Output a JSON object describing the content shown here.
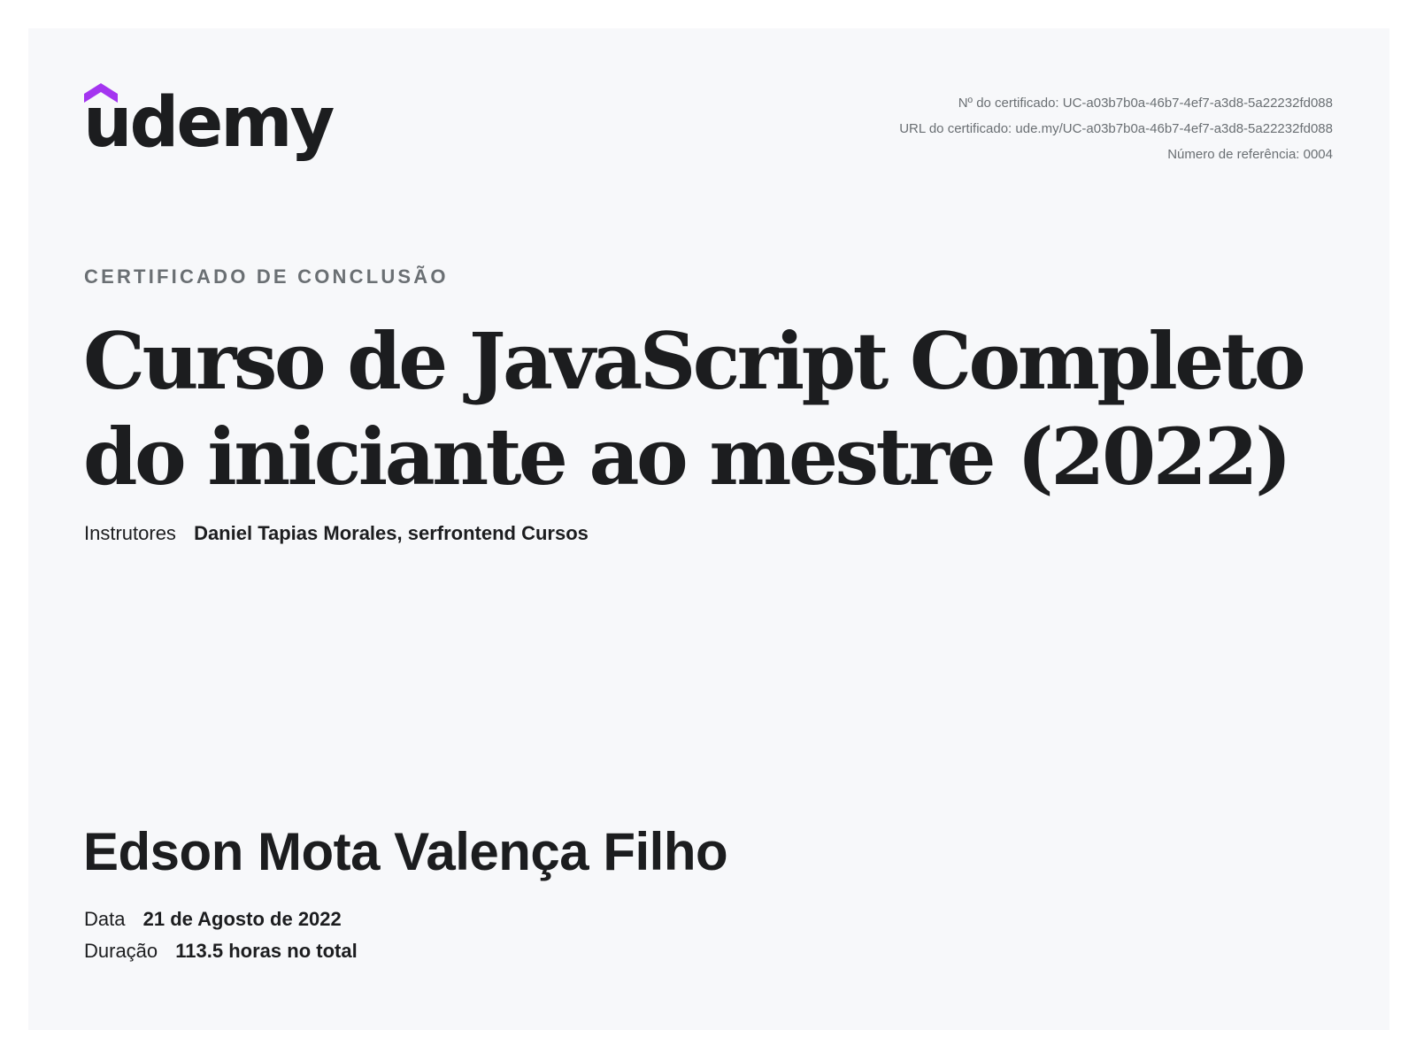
{
  "brand": {
    "name": "udemy",
    "accent_color": "#a435f0"
  },
  "certificate_meta": {
    "number_line": "Nº do certificado: UC-a03b7b0a-46b7-4ef7-a3d8-5a22232fd088",
    "url_line": "URL do certificado: ude.my/UC-a03b7b0a-46b7-4ef7-a3d8-5a22232fd088",
    "reference_line": "Número de referência: 0004"
  },
  "heading": "CERTIFICADO DE CONCLUSÃO",
  "course": {
    "title_line_1": "Curso de JavaScript Completo",
    "title_line_2": "do iniciante ao mestre (2022)"
  },
  "instructors": {
    "label": "Instrutores",
    "names": "Daniel Tapias Morales,  serfrontend Cursos"
  },
  "student": {
    "name": "Edson Mota Valença Filho"
  },
  "date": {
    "label": "Data",
    "value": "21 de Agosto de 2022"
  },
  "duration": {
    "label": "Duração",
    "value": "113.5 horas no total"
  },
  "colors": {
    "page_background": "#ffffff",
    "card_background": "#f7f8fa",
    "text_primary": "#1c1d1f",
    "text_secondary": "#6a6f73"
  }
}
